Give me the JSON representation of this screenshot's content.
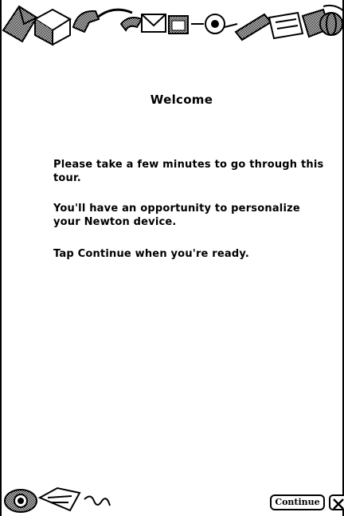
{
  "screen": {
    "title": "Welcome",
    "paragraphs": [
      "Please take a few minutes to go through this tour.",
      "You'll have an opportunity to personalize your Newton device.",
      "Tap Continue when you're ready."
    ]
  },
  "buttons": {
    "continue_label": "Continue",
    "close_icon": "close-box-icon"
  },
  "decorations": {
    "top_border_icons": [
      "envelope-icon",
      "package-icon",
      "phone-icon",
      "mail-icon",
      "calendar-icon",
      "clock-icon",
      "pencil-icon",
      "note-icon",
      "folder-icon",
      "globe-icon"
    ],
    "bottom_border_icons": [
      "globe-icon",
      "envelope-icon",
      "squiggle-icon"
    ]
  }
}
